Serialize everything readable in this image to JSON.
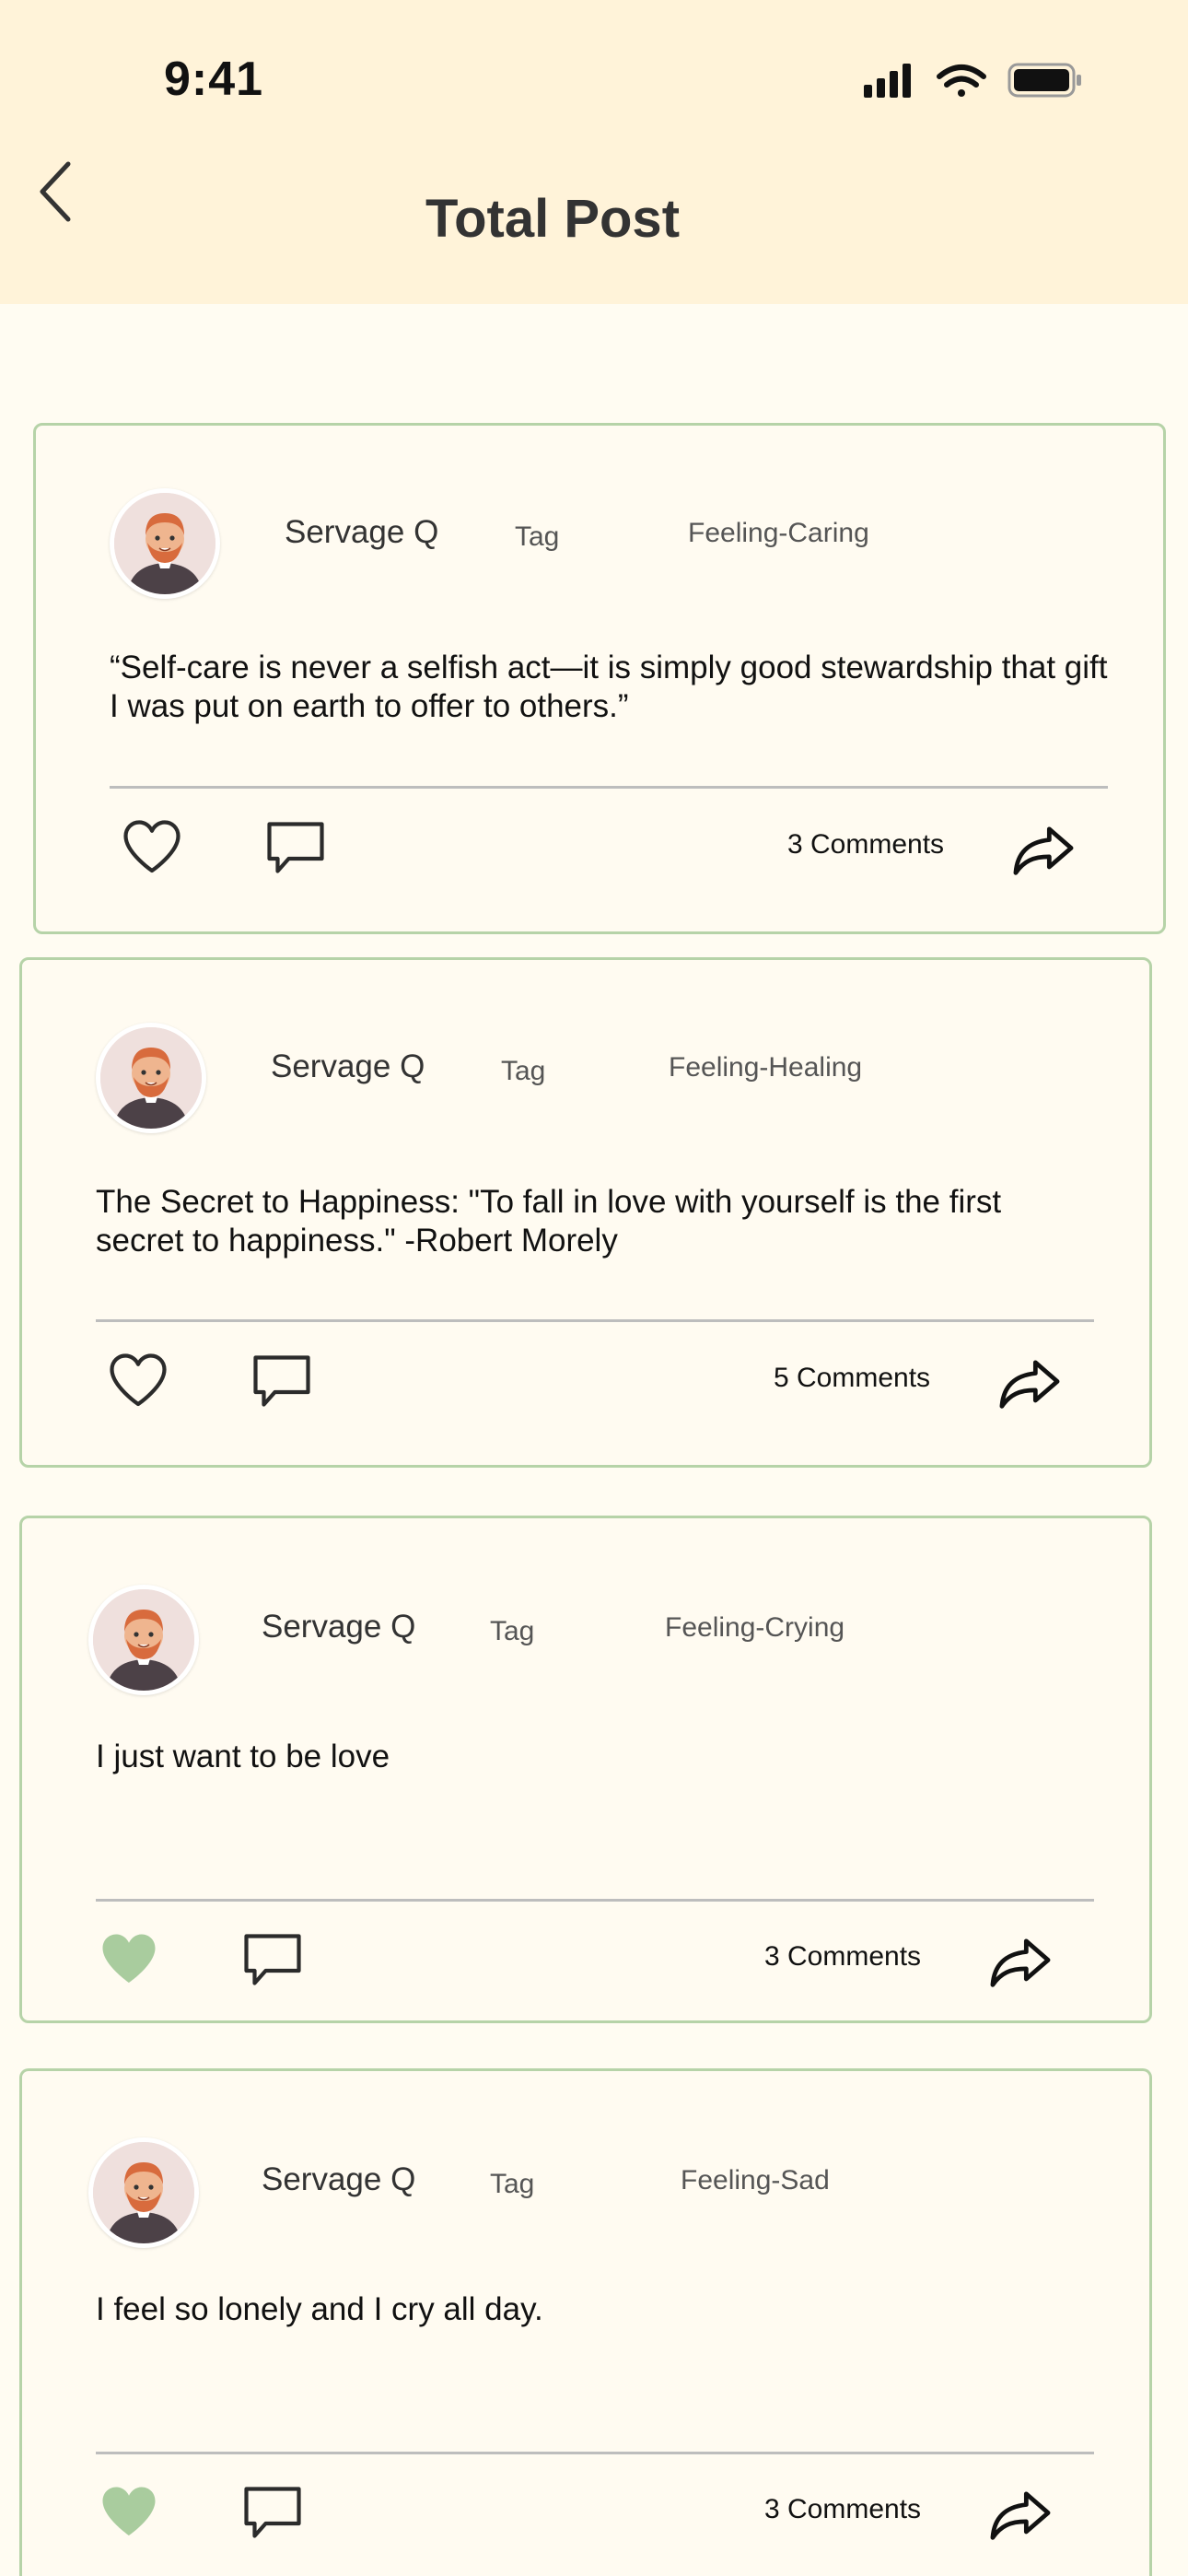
{
  "status_bar": {
    "time": "9:41"
  },
  "header": {
    "title": "Total Post"
  },
  "posts": [
    {
      "author": "Servage Q",
      "tag": "Tag",
      "feeling": "Feeling-Caring",
      "text": "“Self-care is never a selfish act—it is simply good stewardship that gift I was put on earth to offer to others.”",
      "comments": "3 Comments",
      "liked": false
    },
    {
      "author": "Servage Q",
      "tag": "Tag",
      "feeling": "Feeling-Healing",
      "text": "The Secret to Happiness: \"To fall in love with yourself is the first secret to happiness.\" -Robert Morely",
      "comments": "5 Comments",
      "liked": false
    },
    {
      "author": "Servage Q",
      "tag": "Tag",
      "feeling": "Feeling-Crying",
      "text": "I just want to be love",
      "comments": "3 Comments",
      "liked": true
    },
    {
      "author": "Servage Q",
      "tag": "Tag",
      "feeling": "Feeling-Sad",
      "text": "I feel so lonely and I cry all day.",
      "comments": "3 Comments",
      "liked": true
    }
  ],
  "icons": {
    "like": "heart-icon",
    "comment": "comment-icon",
    "share": "share-icon",
    "back": "chevron-left-icon"
  },
  "colors": {
    "header_bg": "#fff3d9",
    "card_border": "#b6d3a8",
    "liked_heart": "#a9cc9e"
  }
}
